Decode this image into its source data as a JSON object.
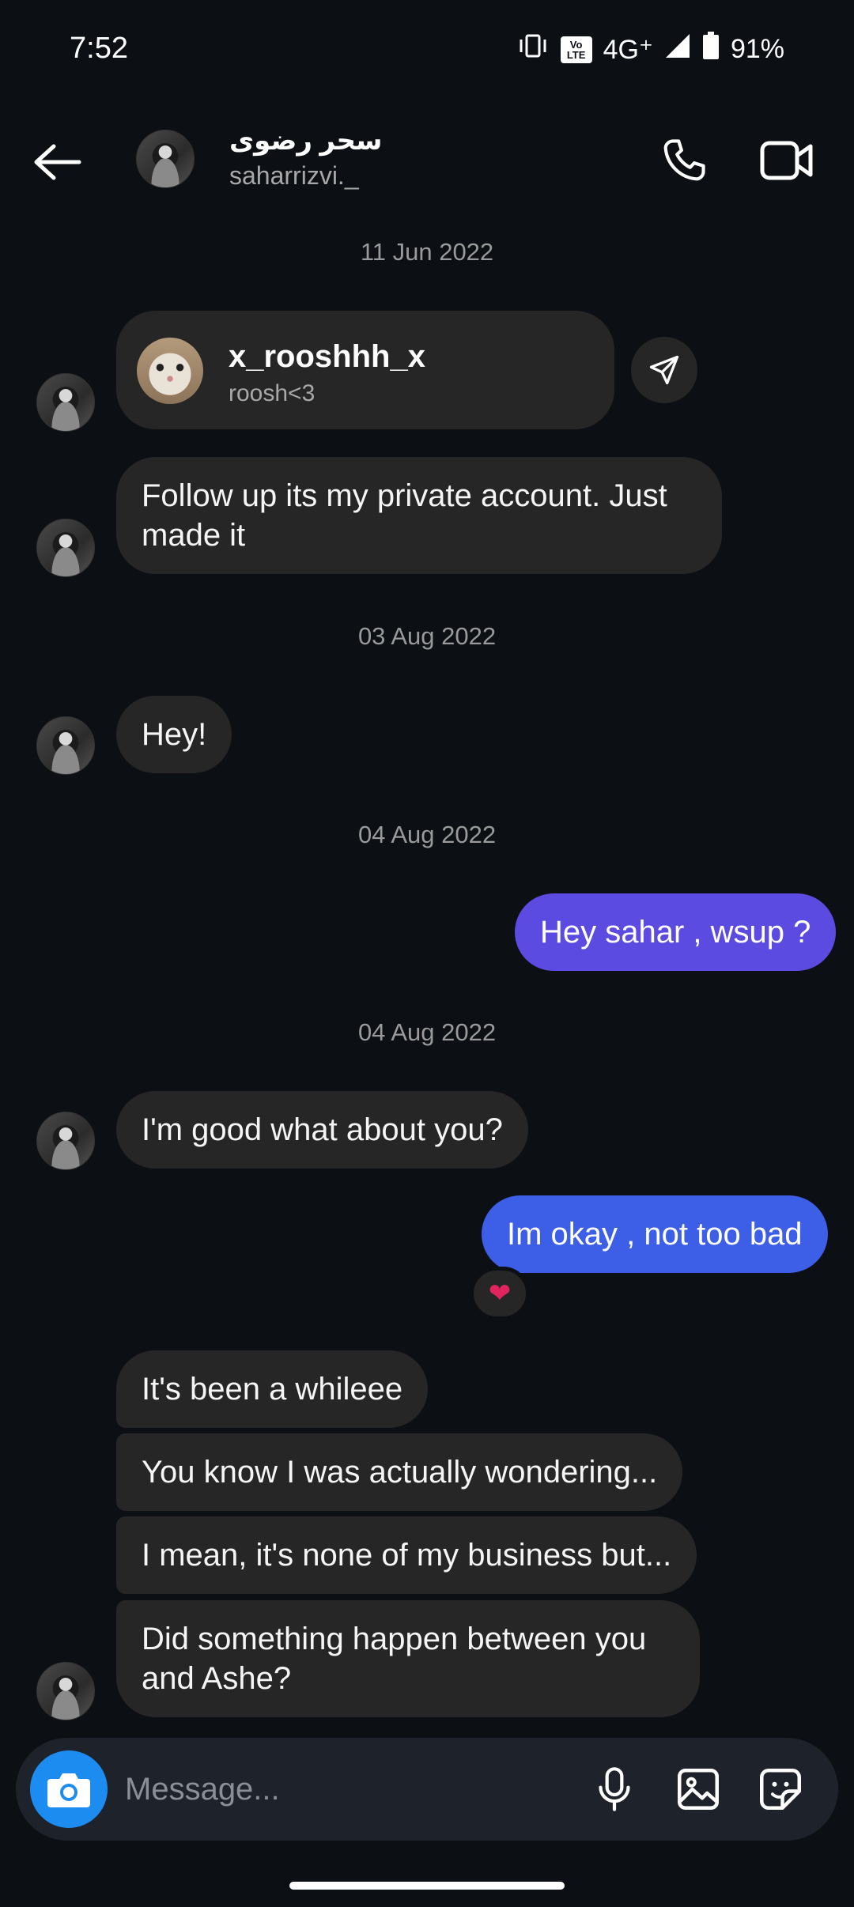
{
  "status_bar": {
    "time": "7:52",
    "volte_top": "Vo",
    "volte_bottom": "LTE",
    "network": "4G⁺",
    "battery": "91%"
  },
  "header": {
    "name": "سحر رضوی",
    "username": "saharrizvi._"
  },
  "shared_profile": {
    "name": "x_rooshhh_x",
    "subtitle": "roosh<3"
  },
  "dates": {
    "d1": "11 Jun 2022",
    "d2": "03 Aug 2022",
    "d3": "04 Aug 2022",
    "d4": "04 Aug 2022"
  },
  "messages": {
    "m1": "Follow up its my private account. Just made it",
    "m2": "Hey!",
    "m3": "Hey sahar , wsup ?",
    "m4": "I'm good what about you?",
    "m5": "Im okay , not too bad",
    "m6": "It's been a whileee",
    "m7": "You know I was actually wondering...",
    "m8": "I mean, it's none of my business but...",
    "m9": "Did something happen between you and Ashe?"
  },
  "reaction": "❤",
  "composer": {
    "placeholder": "Message..."
  },
  "colors": {
    "outgoing_top": "#5b4be0",
    "outgoing_bottom": "#3d5fe8",
    "incoming": "#262626",
    "background": "#0c0f14",
    "camera_button": "#1d8cf0"
  }
}
